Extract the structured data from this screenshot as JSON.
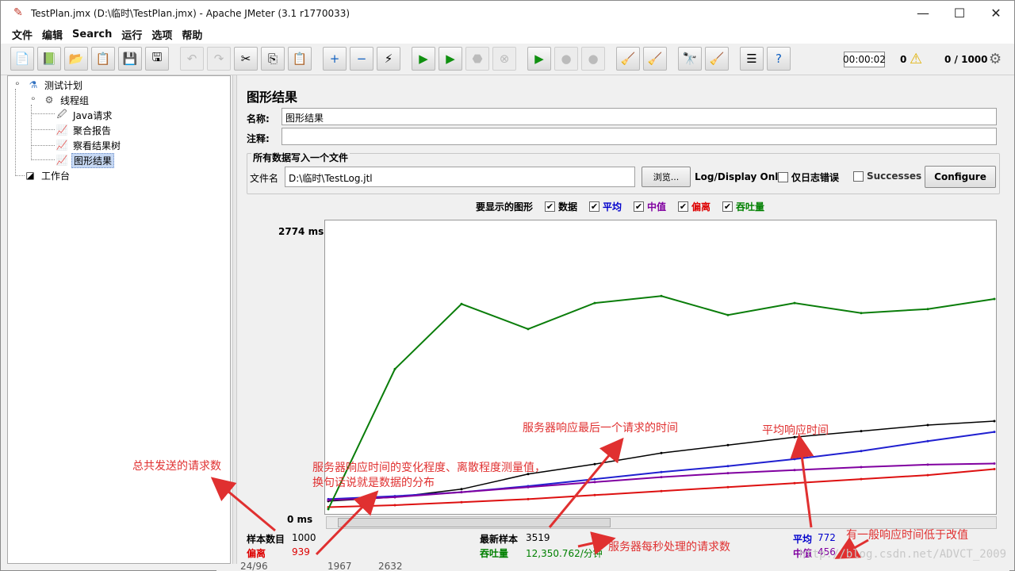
{
  "window": {
    "title": "TestPlan.jmx (D:\\临时\\TestPlan.jmx) - Apache JMeter (3.1 r1770033)",
    "controls": {
      "minimize": "—",
      "maximize": "☐",
      "close": "✕"
    }
  },
  "menubar": [
    "文件",
    "编辑",
    "Search",
    "运行",
    "选项",
    "帮助"
  ],
  "status": {
    "timer": "00:00:02",
    "errors": "0",
    "threads": "0 / 1000"
  },
  "tree": {
    "nodes": [
      "测试计划",
      "线程组",
      "Java请求",
      "聚合报告",
      "察看结果树",
      "图形结果",
      "工作台"
    ],
    "selected": "图形结果"
  },
  "panel": {
    "title": "图形结果",
    "name_label": "名称:",
    "name_value": "图形结果",
    "comment_label": "注释:",
    "comment_value": "",
    "group_title": "所有数据写入一个文件",
    "file_label": "文件名",
    "file_value": "D:\\临时\\TestLog.jtl",
    "browse_button": "浏览...",
    "log_display_label": "Log/Display Only:",
    "errors_only_label": "仅日志错误",
    "successes_label": "Successes",
    "configure_button": "Configure"
  },
  "graph_options": {
    "label": "要显示的图形",
    "items": [
      {
        "label": "数据",
        "color": "#000000",
        "checked": true
      },
      {
        "label": "平均",
        "color": "#0000cc",
        "checked": true
      },
      {
        "label": "中值",
        "color": "#8000a0",
        "checked": true
      },
      {
        "label": "偏离",
        "color": "#dd0000",
        "checked": true
      },
      {
        "label": "吞吐量",
        "color": "#008000",
        "checked": true
      }
    ]
  },
  "axis": {
    "top": "2774 ms",
    "bottom": "0 ms"
  },
  "stats": {
    "samples_label": "样本数目",
    "samples_value": "1000",
    "deviation_label": "偏离",
    "deviation_value": "939",
    "latest_label": "最新样本",
    "latest_value": "3519",
    "throughput_label": "吞吐量",
    "throughput_value": "12,350.762/分钟",
    "average_label": "平均",
    "average_value": "772",
    "median_label": "中值",
    "median_value": "456"
  },
  "annotations": {
    "total_requests": "总共发送的请求数",
    "deviation_1": "服务器响应时间的变化程度、离散程度测量值，",
    "deviation_2": "换句话说就是数据的分布",
    "latest": "服务器响应最后一个请求的时间",
    "average": "平均响应时间",
    "throughput": "服务器每秒处理的请求数",
    "median": "有一般响应时间低于改值"
  },
  "watermark": "http://blog.csdn.net/ADVCT_2009",
  "background_row": {
    "col1": "24/96",
    "col2": "1967",
    "col3": "2632"
  },
  "colors": {
    "data": "#000000",
    "average": "#2020d0",
    "median": "#8000a0",
    "deviation": "#dd1010",
    "throughput": "#0a7d0a",
    "annotation": "#e03030"
  },
  "chart_data": {
    "type": "line",
    "ylim": [
      0,
      2774
    ],
    "x": [
      0,
      100,
      200,
      300,
      400,
      500,
      600,
      700,
      800,
      900,
      1000
    ],
    "series": [
      {
        "name": "数据",
        "values": [
          80,
          120,
          200,
          350,
          450,
          560,
          640,
          720,
          780,
          840,
          880
        ]
      },
      {
        "name": "平均",
        "values": [
          100,
          130,
          170,
          230,
          300,
          370,
          430,
          500,
          580,
          680,
          772
        ]
      },
      {
        "name": "中值",
        "values": [
          90,
          120,
          170,
          220,
          270,
          320,
          360,
          390,
          420,
          445,
          456
        ]
      },
      {
        "name": "偏离",
        "values": [
          20,
          40,
          70,
          100,
          140,
          180,
          220,
          260,
          300,
          340,
          400
        ]
      },
      {
        "name": "吞吐量",
        "values": [
          0,
          1400,
          2050,
          1800,
          2060,
          2130,
          1940,
          2060,
          1960,
          2000,
          2100
        ]
      }
    ]
  }
}
